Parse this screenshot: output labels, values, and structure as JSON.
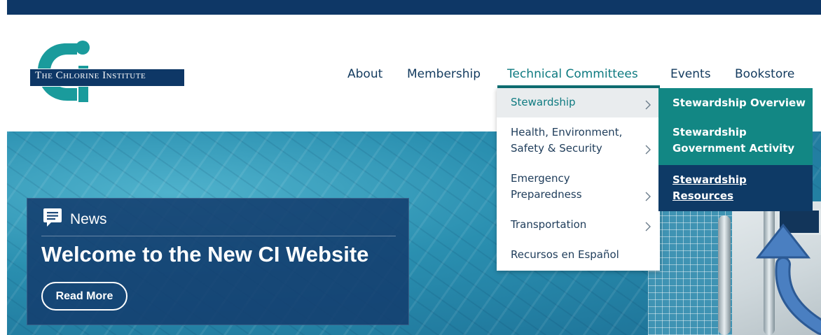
{
  "logo": {
    "text_prefix_1": "T",
    "text_sc_1": "he",
    "text_prefix_2": " C",
    "text_sc_2": "hlorine",
    "text_prefix_3": " I",
    "text_sc_3": "nstitute",
    "accent_color": "#1a9b9c"
  },
  "nav": {
    "about": "About",
    "membership": "Membership",
    "technical_committees": "Technical Committees",
    "events": "Events",
    "bookstore": "Bookstore"
  },
  "dropdown": {
    "items": [
      {
        "line1": "Stewardship",
        "line2": ""
      },
      {
        "line1": "Health, Environment,",
        "line2": "Safety & Security"
      },
      {
        "line1": "Emergency",
        "line2": "Preparedness"
      },
      {
        "line1": "Transportation",
        "line2": ""
      },
      {
        "line1": "Recursos en Español",
        "line2": ""
      }
    ]
  },
  "submenu": {
    "items": [
      {
        "line1": "Stewardship Overview",
        "line2": ""
      },
      {
        "line1": "Stewardship",
        "line2": "Government Activity"
      },
      {
        "line1": "Stewardship",
        "line2": "Resources"
      }
    ]
  },
  "news": {
    "label": "News",
    "title": "Welcome to the New CI Website",
    "button": "Read More"
  },
  "colors": {
    "navy": "#0e3766",
    "teal": "#128784",
    "annotation_arrow": "#4a7fc1"
  }
}
